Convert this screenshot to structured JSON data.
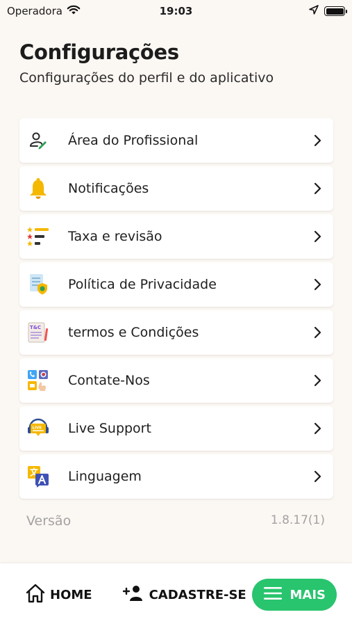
{
  "status_bar": {
    "carrier": "Operadora",
    "time": "19:03",
    "icons": [
      "wifi-icon",
      "location-arrow-icon",
      "battery-icon"
    ]
  },
  "header": {
    "title": "Configurações",
    "subtitle": "Configurações do perfil e do aplicativo"
  },
  "menu": {
    "items": [
      {
        "label": "Área do Profissional",
        "icon": "professional-area-icon"
      },
      {
        "label": "Notificações",
        "icon": "bell-icon"
      },
      {
        "label": "Taxa e revisão",
        "icon": "rating-list-icon"
      },
      {
        "label": "Política de Privacidade",
        "icon": "privacy-policy-icon"
      },
      {
        "label": "termos e Condições",
        "icon": "terms-conditions-icon"
      },
      {
        "label": "Contate-Nos",
        "icon": "contact-icon"
      },
      {
        "label": "Live Support",
        "icon": "live-support-icon"
      },
      {
        "label": "Linguagem",
        "icon": "language-icon"
      }
    ],
    "chevron_icon": "chevron-right-icon"
  },
  "version": {
    "label": "Versão",
    "value": "1.8.17(1)"
  },
  "bottom_nav": {
    "home_label": "HOME",
    "register_label": "CADASTRE-SE",
    "more_label": "MAIS"
  },
  "colors": {
    "background": "#fbf7f3",
    "accent_green": "#29c46e",
    "bell_yellow": "#f5b800"
  },
  "icons_legend": {
    "t_and_c_text": "T&C",
    "live_text": "LIVE"
  }
}
